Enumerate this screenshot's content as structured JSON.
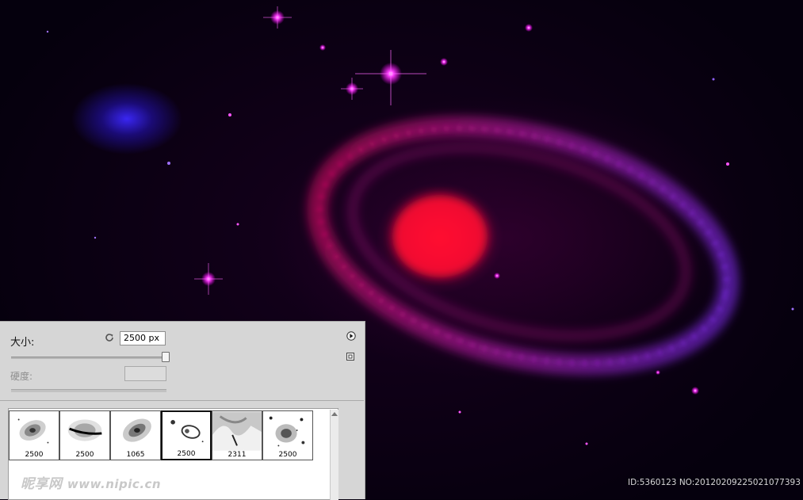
{
  "brush": {
    "size_label": "大小:",
    "size_value": "2500 px",
    "size_fraction": 0.97,
    "hardness_label": "硬度:",
    "hardness_value": ""
  },
  "presets": [
    {
      "size": "2500",
      "icon": "spiral-galaxy-brush-icon",
      "selected": false
    },
    {
      "size": "2500",
      "icon": "edge-on-galaxy-brush-icon",
      "selected": false
    },
    {
      "size": "1065",
      "icon": "elliptical-galaxy-brush-icon",
      "selected": false
    },
    {
      "size": "2500",
      "icon": "ring-galaxy-brush-icon",
      "selected": true
    },
    {
      "size": "2311",
      "icon": "nebula-cloud-brush-icon",
      "selected": false
    },
    {
      "size": "2500",
      "icon": "starfield-galaxy-brush-icon",
      "selected": false
    }
  ],
  "watermark": {
    "text": "昵享网",
    "url": "www.nipic.cn"
  },
  "id_text": "ID:5360123 NO:20120209225021077393",
  "colors": {
    "space": "#05000d",
    "galaxy_core": "#ff1020",
    "galaxy_ring": "#b030e0",
    "blue_galaxy": "#3c28ff",
    "panel": "#d6d6d6"
  }
}
